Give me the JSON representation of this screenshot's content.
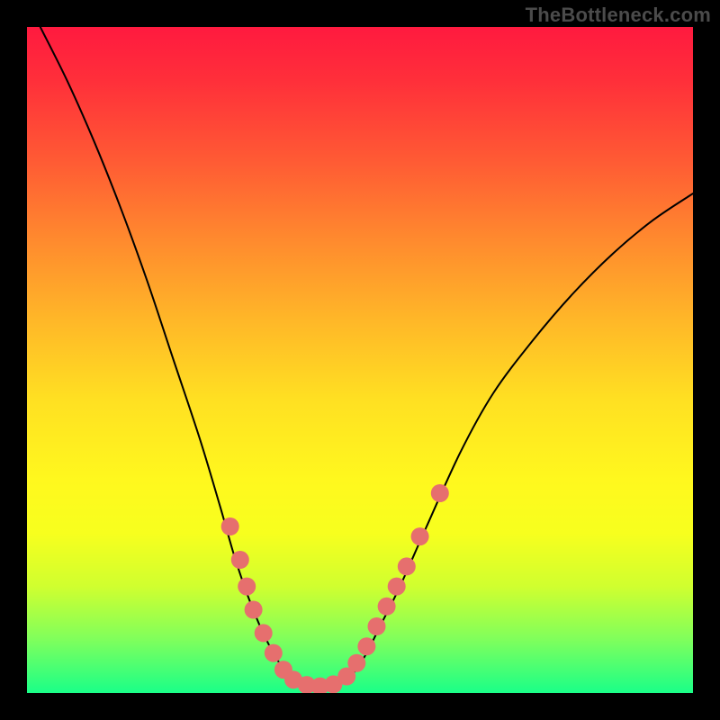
{
  "watermark": "TheBottleneck.com",
  "chart_data": {
    "type": "line",
    "title": "",
    "xlabel": "",
    "ylabel": "",
    "xlim": [
      0,
      100
    ],
    "ylim": [
      0,
      100
    ],
    "curve": [
      {
        "x": 2,
        "y": 100
      },
      {
        "x": 6,
        "y": 92
      },
      {
        "x": 10,
        "y": 83
      },
      {
        "x": 14,
        "y": 73
      },
      {
        "x": 18,
        "y": 62
      },
      {
        "x": 22,
        "y": 50
      },
      {
        "x": 26,
        "y": 38
      },
      {
        "x": 29,
        "y": 28
      },
      {
        "x": 31,
        "y": 21
      },
      {
        "x": 33,
        "y": 15
      },
      {
        "x": 35,
        "y": 10
      },
      {
        "x": 37,
        "y": 6
      },
      {
        "x": 39,
        "y": 3
      },
      {
        "x": 41,
        "y": 1.5
      },
      {
        "x": 43,
        "y": 1
      },
      {
        "x": 45,
        "y": 1
      },
      {
        "x": 47,
        "y": 1.5
      },
      {
        "x": 49,
        "y": 3
      },
      {
        "x": 51,
        "y": 6
      },
      {
        "x": 53,
        "y": 10
      },
      {
        "x": 56,
        "y": 16
      },
      {
        "x": 60,
        "y": 25
      },
      {
        "x": 65,
        "y": 36
      },
      {
        "x": 70,
        "y": 45
      },
      {
        "x": 76,
        "y": 53
      },
      {
        "x": 82,
        "y": 60
      },
      {
        "x": 88,
        "y": 66
      },
      {
        "x": 94,
        "y": 71
      },
      {
        "x": 100,
        "y": 75
      }
    ],
    "dots": [
      {
        "x": 30.5,
        "y": 25
      },
      {
        "x": 32,
        "y": 20
      },
      {
        "x": 33,
        "y": 16
      },
      {
        "x": 34,
        "y": 12.5
      },
      {
        "x": 35.5,
        "y": 9
      },
      {
        "x": 37,
        "y": 6
      },
      {
        "x": 38.5,
        "y": 3.5
      },
      {
        "x": 40,
        "y": 2
      },
      {
        "x": 42,
        "y": 1.2
      },
      {
        "x": 44,
        "y": 1
      },
      {
        "x": 46,
        "y": 1.3
      },
      {
        "x": 48,
        "y": 2.5
      },
      {
        "x": 49.5,
        "y": 4.5
      },
      {
        "x": 51,
        "y": 7
      },
      {
        "x": 52.5,
        "y": 10
      },
      {
        "x": 54,
        "y": 13
      },
      {
        "x": 55.5,
        "y": 16
      },
      {
        "x": 57,
        "y": 19
      },
      {
        "x": 59,
        "y": 23.5
      },
      {
        "x": 62,
        "y": 30
      }
    ],
    "dot_radius": 10,
    "colors": {
      "curve": "#000000",
      "dots": "#e66f6e",
      "gradient_top": "#ff1a3f",
      "gradient_mid": "#fff81e",
      "gradient_bottom": "#1aff88",
      "background": "#000000",
      "watermark": "#4b4b4b"
    }
  }
}
